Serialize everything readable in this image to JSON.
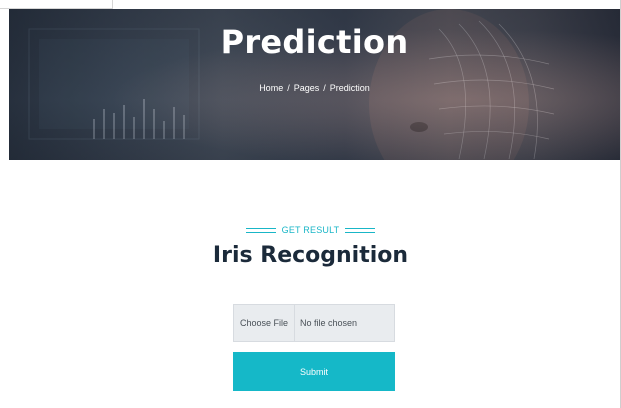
{
  "hero": {
    "title": "Prediction",
    "breadcrumb": {
      "home": "Home",
      "pages": "Pages",
      "current": "Prediction",
      "separator": "/"
    }
  },
  "section": {
    "eyebrow": "GET RESULT",
    "title": "Iris Recognition"
  },
  "upload": {
    "button_label": "Choose File",
    "status_text": "No file chosen"
  },
  "submit": {
    "label": "Submit"
  },
  "colors": {
    "accent": "#15b8c8",
    "heading": "#1b2a3a",
    "input_bg": "#e9ecef"
  }
}
